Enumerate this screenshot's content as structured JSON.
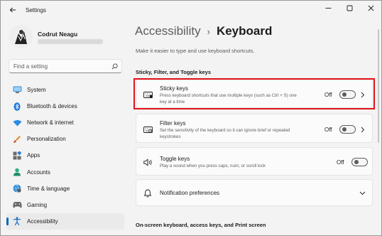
{
  "window": {
    "title": "Settings"
  },
  "user": {
    "name": "Codrut Neagu"
  },
  "search": {
    "placeholder": "Find a setting"
  },
  "sidebar": {
    "items": [
      {
        "label": "System",
        "icon": "monitor-icon"
      },
      {
        "label": "Bluetooth & devices",
        "icon": "bluetooth-icon"
      },
      {
        "label": "Network & internet",
        "icon": "wifi-icon"
      },
      {
        "label": "Personalization",
        "icon": "brush-icon"
      },
      {
        "label": "Apps",
        "icon": "apps-icon"
      },
      {
        "label": "Accounts",
        "icon": "person-icon"
      },
      {
        "label": "Time & language",
        "icon": "globe-clock-icon"
      },
      {
        "label": "Gaming",
        "icon": "gamepad-icon"
      },
      {
        "label": "Accessibility",
        "icon": "accessibility-icon",
        "active": true
      }
    ]
  },
  "breadcrumb": {
    "parent": "Accessibility",
    "separator": "›",
    "current": "Keyboard"
  },
  "page": {
    "description": "Make it easier to type and use keyboard shortcuts."
  },
  "sections": [
    {
      "title": "Sticky, Filter, and Toggle keys"
    },
    {
      "title": "On-screen keyboard, access keys, and Print screen"
    }
  ],
  "settings": {
    "sticky": {
      "title": "Sticky keys",
      "desc1": "Press keyboard shortcuts that use multiple keys (such as Ctrl + S) one",
      "desc2": "key at a time",
      "state": "Off"
    },
    "filter": {
      "title": "Filter keys",
      "desc1": "Set the sensitivity of the keyboard so it can ignore brief or repeated",
      "desc2": "keystrokes",
      "state": "Off"
    },
    "toggle": {
      "title": "Toggle keys",
      "desc1": "Play a sound when you press caps, num, or scroll lock",
      "state": "Off"
    },
    "notification": {
      "title": "Notification preferences"
    }
  },
  "colors": {
    "accent": "#0067c0",
    "highlight": "#e3131b"
  }
}
